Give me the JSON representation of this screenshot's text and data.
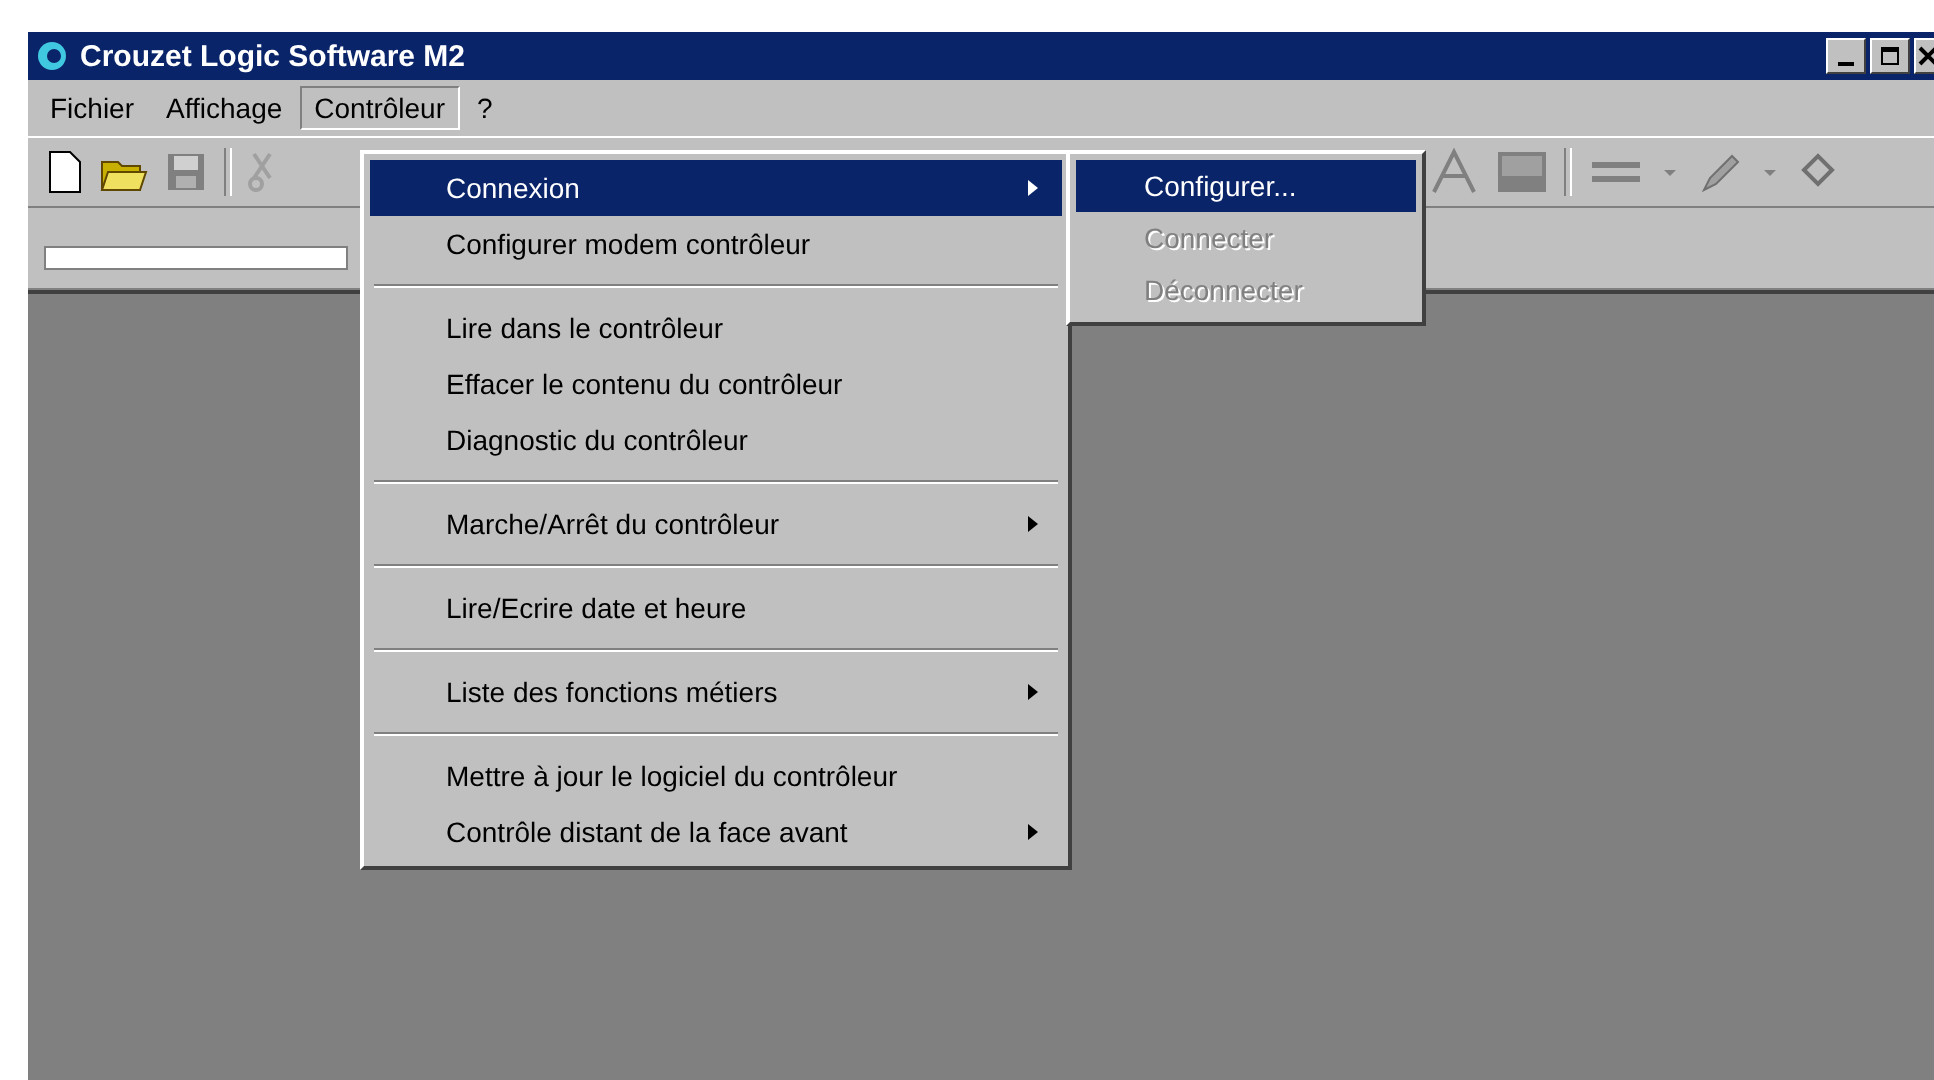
{
  "window": {
    "title": "Crouzet Logic Software M2"
  },
  "menu_bar": [
    {
      "label": "Fichier",
      "selected": false
    },
    {
      "label": "Affichage",
      "selected": false
    },
    {
      "label": "Contrôleur",
      "selected": true
    },
    {
      "label": "?",
      "selected": false
    }
  ],
  "menu": {
    "groups": [
      [
        {
          "label": "Connexion",
          "selected": true,
          "submenu": true
        },
        {
          "label": "Configurer modem contrôleur",
          "selected": false,
          "submenu": false
        }
      ],
      [
        {
          "label": "Lire dans le contrôleur",
          "selected": false,
          "submenu": false
        },
        {
          "label": "Effacer le contenu du contrôleur",
          "selected": false,
          "submenu": false
        },
        {
          "label": "Diagnostic du contrôleur",
          "selected": false,
          "submenu": false
        }
      ],
      [
        {
          "label": "Marche/Arrêt du contrôleur",
          "selected": false,
          "submenu": true
        }
      ],
      [
        {
          "label": "Lire/Ecrire date et heure",
          "selected": false,
          "submenu": false
        }
      ],
      [
        {
          "label": "Liste des fonctions métiers",
          "selected": false,
          "submenu": true
        }
      ],
      [
        {
          "label": "Mettre à jour le logiciel du contrôleur",
          "selected": false,
          "submenu": false
        },
        {
          "label": "Contrôle distant de la face avant",
          "selected": false,
          "submenu": true
        }
      ]
    ]
  },
  "submenu": [
    {
      "label": "Configurer...",
      "selected": true,
      "disabled": false
    },
    {
      "label": "Connecter",
      "selected": false,
      "disabled": true
    },
    {
      "label": "Déconnecter",
      "selected": false,
      "disabled": true
    }
  ]
}
